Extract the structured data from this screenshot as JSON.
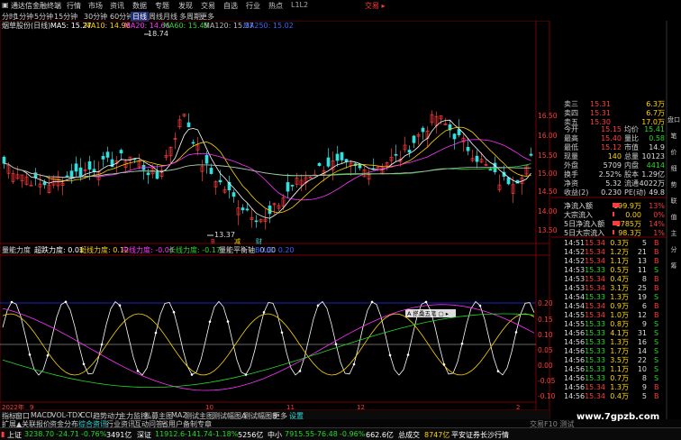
{
  "titlebar": {
    "app_title": "通达信金融终端",
    "menus": [
      "行情",
      "市场",
      "资讯",
      "数据",
      "专题",
      "发现",
      "交易",
      "自选",
      "行业",
      "热点",
      "L1L2"
    ],
    "right_label": "交易 ▸"
  },
  "period_tabs": [
    "分时",
    "1分钟",
    "5分钟",
    "15分钟",
    "30分钟",
    "60分钟",
    "日线",
    "周线",
    "月线",
    "多周期",
    "更多"
  ],
  "active_period": "日线",
  "ma_legend": {
    "stock": "烟草股份(日线)",
    "ma5": "MA5: 15.27",
    "ma10": "MA10: 14.96",
    "ma20": "MA20: 14.66",
    "ma60": "MA60: 15.45",
    "ma120": "MA120: 15.37",
    "ma250": "MA250: 15.02"
  },
  "price_labels": {
    "high": "18.74",
    "low": "13.37"
  },
  "signal_marks": [
    "B",
    "减",
    "财"
  ],
  "y_axis_main": [
    "16.50",
    "16.00",
    "15.50",
    "15.00",
    "14.50",
    "14.00",
    "13.50"
  ],
  "indicator": {
    "name": "量能力度",
    "l1": "超跌力度: 0.01",
    "l2": "斑线力度: 0.12",
    "l3": "中线力度: -0.04",
    "l4": "长线力度: -0.17",
    "l5": "量能平衡轴: 0.00",
    "l6": "BLUE: 0.20",
    "popup": "A 搭桑五笔 ▢ ▸"
  },
  "y_axis_ind": [
    "0.20",
    "0.15",
    "0.10",
    "0.05",
    "0.00",
    "-0.05",
    "-0.10"
  ],
  "x_axis": [
    "2022年",
    "9",
    "10",
    "11",
    "12",
    "2"
  ],
  "quote": {
    "asks": [
      {
        "label": "卖三",
        "price": "15.31",
        "vol": "6.3万"
      },
      {
        "label": "卖四",
        "price": "15.31",
        "vol": "6.7万"
      },
      {
        "label": "卖五",
        "price": "15.30",
        "vol": "17.0万"
      }
    ],
    "stats": [
      {
        "l1": "今开",
        "v1": "15.15",
        "l2": "均价",
        "v2": "15.41"
      },
      {
        "l1": "最高",
        "v1": "15.40",
        "l2": "量比",
        "v2": "0.58"
      },
      {
        "l1": "最低",
        "v1": "15.12",
        "l2": "市值",
        "v2": "14.9"
      },
      {
        "l1": "现量",
        "v1": "140",
        "l2": "总量",
        "v2": "10123"
      },
      {
        "l1": "外盘",
        "v1": "5709",
        "v1b": "内盘",
        "v2": "4414"
      },
      {
        "l1": "换手",
        "v1": "2.52%",
        "l2": "股本",
        "v2": "1.29亿"
      },
      {
        "l1": "净资",
        "v1": "5.32",
        "l2": "流通",
        "v2": "4022万"
      },
      {
        "l1": "收益(2)",
        "v1": "0.230",
        "l2": "PE(动)",
        "v2": "49.8"
      }
    ],
    "flows": [
      {
        "label": "净流入额",
        "v": "199.9万",
        "p": "13%"
      },
      {
        "label": "大宗流入",
        "v": "0.00",
        "p": "0%"
      },
      {
        "label": "5日净流入额",
        "v": "1785万",
        "p": "14%"
      },
      {
        "label": "5日大宗流入",
        "v": "98.3万",
        "p": "1%"
      }
    ],
    "ticks": [
      {
        "t": "14:51",
        "p": "15.34",
        "v": "0.3万",
        "n": "5",
        "d": "B"
      },
      {
        "t": "14:52",
        "p": "15.34",
        "v": "1.2万",
        "n": "21",
        "d": "B"
      },
      {
        "t": "14:52",
        "p": "15.34",
        "v": "1.1万",
        "n": "13",
        "d": "B"
      },
      {
        "t": "14:53",
        "p": "15.33",
        "v": "0.5万",
        "n": "11",
        "d": "S"
      },
      {
        "t": "14:53",
        "p": "15.34",
        "v": "0.4万",
        "n": "8",
        "d": "B"
      },
      {
        "t": "14:53",
        "p": "15.34",
        "v": "3.1万",
        "n": "25",
        "d": "B"
      },
      {
        "t": "14:54",
        "p": "15.33",
        "v": "1.3万",
        "n": "19",
        "d": "S"
      },
      {
        "t": "14:54",
        "p": "15.34",
        "v": "0.9万",
        "n": "6",
        "d": "B"
      },
      {
        "t": "14:55",
        "p": "15.34",
        "v": "1.0万",
        "n": "12",
        "d": "B"
      },
      {
        "t": "14:55",
        "p": "15.33",
        "v": "0.8万",
        "n": "9",
        "d": "S"
      },
      {
        "t": "14:56",
        "p": "15.33",
        "v": "4.1万",
        "n": "31",
        "d": "S"
      },
      {
        "t": "14:56",
        "p": "15.33",
        "v": "1.3万",
        "n": "16",
        "d": "S"
      },
      {
        "t": "14:56",
        "p": "15.33",
        "v": "1.7万",
        "n": "14",
        "d": "S"
      },
      {
        "t": "14:56",
        "p": "15.33",
        "v": "3.5万",
        "n": "22",
        "d": "S"
      },
      {
        "t": "14:56",
        "p": "15.33",
        "v": "1.1万",
        "n": "10",
        "d": "S"
      },
      {
        "t": "14:56",
        "p": "15.33",
        "v": "0.7万",
        "n": "8",
        "d": "S"
      },
      {
        "t": "14:56",
        "p": "15.34",
        "v": "1.3万",
        "n": "9",
        "d": "B"
      },
      {
        "t": "14:56",
        "p": "15.34",
        "v": "0.4万",
        "n": "5",
        "d": "B"
      }
    ]
  },
  "bottom_tabs_row1": [
    "指标",
    "窗口",
    "MACD",
    "VOL-TDX",
    "CCI",
    "趋势动力",
    "主力监控",
    "私募主图",
    "MA2",
    "测试主图",
    "测试幅图A",
    "测试幅图B",
    "更多",
    "设置"
  ],
  "bottom_tabs_row2": [
    "扩展▲",
    "关联报价",
    "资金分布",
    "综合资讯",
    "行业资讯",
    "互动问答",
    "省用户备制专章"
  ],
  "side_tabs": [
    "盘口",
    "笔",
    "价",
    "细",
    "势",
    "联",
    "值",
    "主",
    "分",
    "筹"
  ],
  "status": {
    "sh_label": "上证",
    "sh_val": "3238.70",
    "sh_chg": "-24.71",
    "sh_pct": "-0.76%",
    "sh_amt": "3491亿",
    "sz_label": "深证",
    "sz_val": "11912.6",
    "sz_chg": "-141.74",
    "sz_pct": "-1.18%",
    "sz_amt": "5256亿",
    "zx_label": "中小",
    "zx_val": "7915.55",
    "zx_chg": "-76.48",
    "zx_pct": "-0.96%",
    "zx_amt": "662.6亿",
    "total_label": "总成交",
    "total": "8747亿",
    "news": "平安证券长沙行情",
    "watermark": "www.7gpzb.com",
    "ver": "交易F10 测试"
  }
}
